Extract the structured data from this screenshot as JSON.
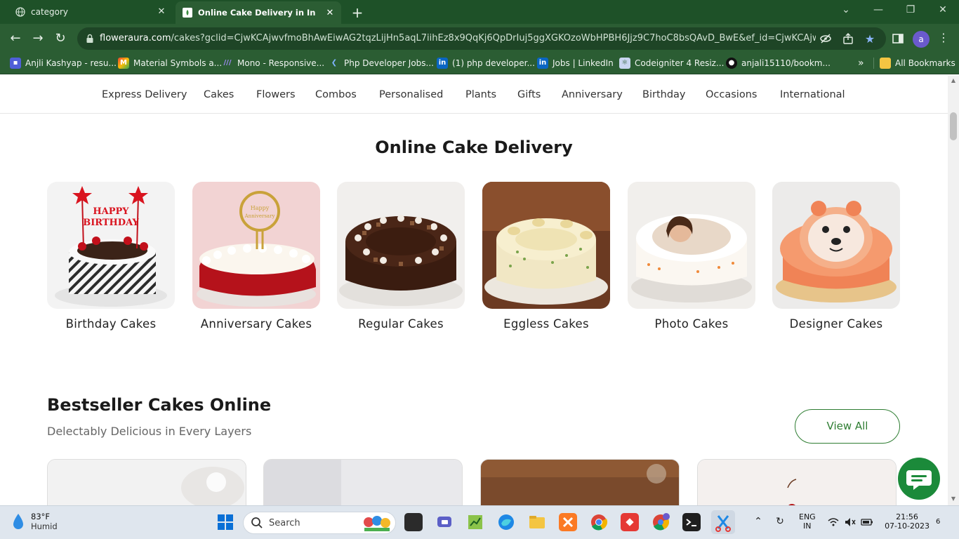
{
  "browser": {
    "tabs": [
      {
        "label": "category"
      },
      {
        "label": "Online Cake Delivery in India | C"
      }
    ],
    "url_host": "floweraura.com",
    "url_path": "/cakes?gclid=CjwKCAjwvfmoBhAwEiwAG2tqzLijHn5aqL7iihEz8x9QqKj6QpDrIuj5ggXGKOzoWbHPBH6Jjz9C7hoC8bsQAvD_BwE&ef_id=CjwKCAjwvfm...",
    "profile_initial": "a",
    "bookmarks": [
      {
        "label": "Anjli Kashyap - resu...",
        "icon": "bookmark-doc-icon"
      },
      {
        "label": "Material Symbols a...",
        "icon": "material-icon"
      },
      {
        "label": "Mono - Responsive...",
        "icon": "mono-icon"
      },
      {
        "label": "Php Developer Jobs...",
        "icon": "php-icon"
      },
      {
        "label": "(1) php developer...",
        "icon": "linkedin-icon"
      },
      {
        "label": "Jobs | LinkedIn",
        "icon": "linkedin-icon"
      },
      {
        "label": "Codeigniter 4 Resiz...",
        "icon": "react-icon"
      },
      {
        "label": "anjali15110/bookm...",
        "icon": "github-icon"
      }
    ],
    "more_bookmarks": "»",
    "all_bookmarks": "All Bookmarks"
  },
  "nav": {
    "items": [
      "Express Delivery",
      "Cakes",
      "Flowers",
      "Combos",
      "Personalised",
      "Plants",
      "Gifts",
      "Anniversary",
      "Birthday",
      "Occasions",
      "International"
    ]
  },
  "main": {
    "title": "Online Cake Delivery",
    "categories": [
      {
        "name": "Birthday Cakes"
      },
      {
        "name": "Anniversary Cakes"
      },
      {
        "name": "Regular Cakes"
      },
      {
        "name": "Eggless Cakes"
      },
      {
        "name": "Photo Cakes"
      },
      {
        "name": "Designer Cakes"
      }
    ]
  },
  "bestseller": {
    "title": "Bestseller Cakes Online",
    "subtitle": "Delectably Delicious in Every Layers",
    "view_all": "View All"
  },
  "taskbar": {
    "temperature": "83°F",
    "condition": "Humid",
    "search_placeholder": "Search",
    "language": "ENG",
    "region": "IN",
    "time": "21:56",
    "date": "07-10-2023",
    "notification_count": "6"
  },
  "colors": {
    "chrome_dark": "#1e5128",
    "chrome": "#2b5d33",
    "accent_green": "#2e7d32",
    "chat_green": "#1b8a3a"
  }
}
